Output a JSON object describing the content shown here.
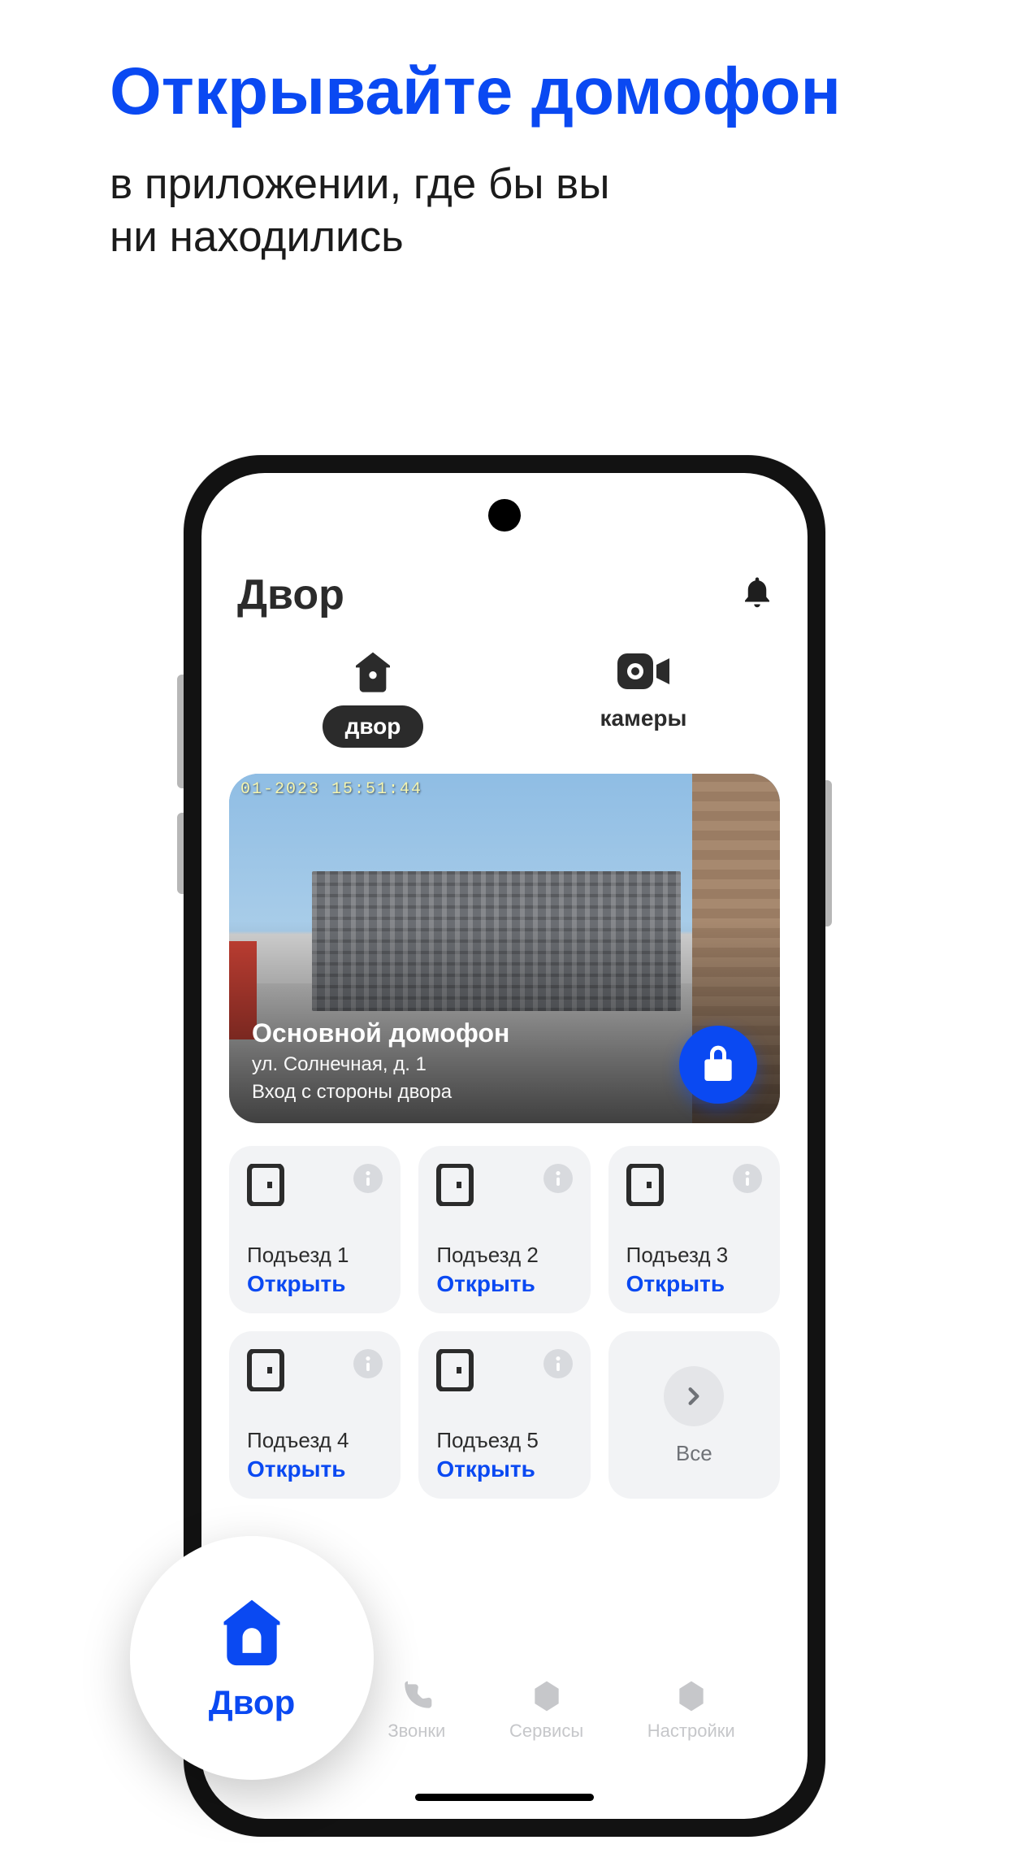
{
  "hero": {
    "title": "Открывайте домофон",
    "subtitle": "в приложении, где бы вы\nни находились"
  },
  "header": {
    "title": "Двор"
  },
  "segments": {
    "yard": "двор",
    "cameras": "камеры"
  },
  "camera": {
    "timestamp": "01-2023  15:51:44",
    "title": "Основной домофон",
    "address": "ул. Солнечная, д. 1",
    "entry_side": "Вход с стороны двора"
  },
  "doors": [
    {
      "name": "Подъезд 1",
      "action": "Открыть"
    },
    {
      "name": "Подъезд 2",
      "action": "Открыть"
    },
    {
      "name": "Подъезд 3",
      "action": "Открыть"
    },
    {
      "name": "Подъезд 4",
      "action": "Открыть"
    },
    {
      "name": "Подъезд 5",
      "action": "Открыть"
    }
  ],
  "all_label": "Все",
  "nav": {
    "yard": "Двор",
    "calls": "Звонки",
    "services": "Сервисы",
    "settings": "Настройки"
  },
  "colors": {
    "accent": "#0a49f2"
  }
}
